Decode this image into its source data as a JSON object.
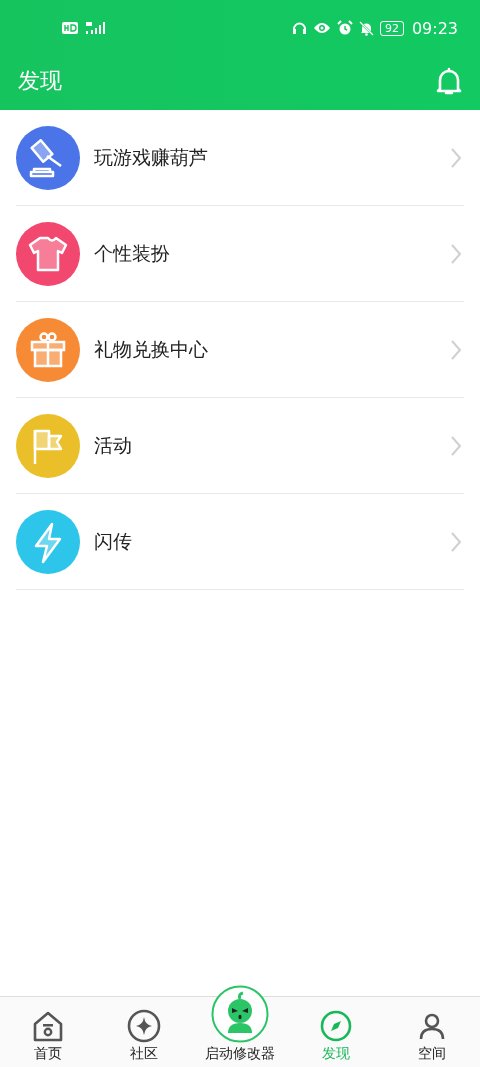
{
  "status_bar": {
    "battery": "92",
    "time": "09:23"
  },
  "header": {
    "title": "发现"
  },
  "items": [
    {
      "label": "玩游戏赚葫芦",
      "kind": "gavel",
      "color": "#4a74e8"
    },
    {
      "label": "个性装扮",
      "kind": "shirt",
      "color": "#f2476e"
    },
    {
      "label": "礼物兑换中心",
      "kind": "gift",
      "color": "#f78a35"
    },
    {
      "label": "活动",
      "kind": "flag",
      "color": "#eabf2a"
    },
    {
      "label": "闪传",
      "kind": "bolt",
      "color": "#2ec5ea"
    }
  ],
  "tabs": [
    {
      "label": "首页",
      "kind": "home",
      "selected": false
    },
    {
      "label": "社区",
      "kind": "sparkle",
      "selected": false
    },
    {
      "label": "启动修改器",
      "kind": "launcher",
      "selected": false
    },
    {
      "label": "发现",
      "kind": "discover",
      "selected": true
    },
    {
      "label": "空间",
      "kind": "space",
      "selected": false
    }
  ]
}
